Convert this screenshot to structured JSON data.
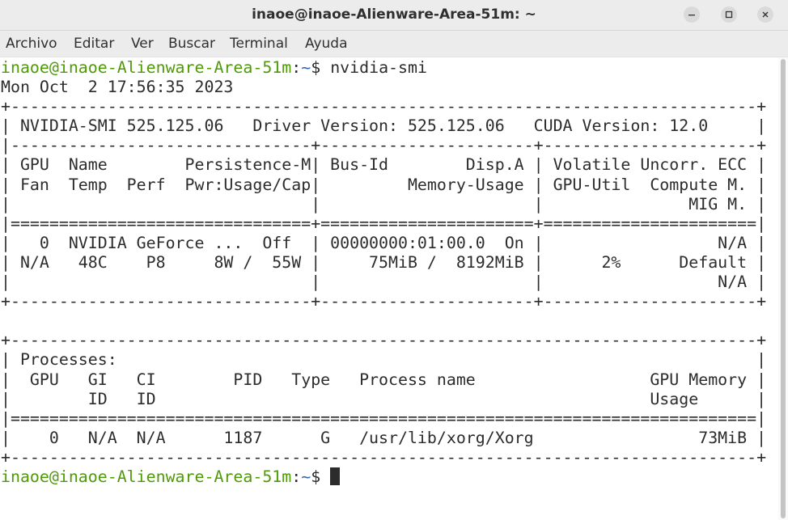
{
  "window": {
    "title": "inaoe@inaoe-Alienware-Area-51m: ~",
    "minimize_icon": "minimize-icon",
    "maximize_icon": "maximize-icon",
    "close_icon": "close-icon"
  },
  "menubar": {
    "items": [
      "Archivo",
      "Editar",
      "Ver",
      "Buscar",
      "Terminal",
      "Ayuda"
    ]
  },
  "terminal": {
    "prompt_user": "inaoe@inaoe-Alienware-Area-51m",
    "prompt_colon": ":",
    "prompt_path": "~",
    "prompt_symbol": "$ ",
    "command": "nvidia-smi",
    "output_lines": [
      "Mon Oct  2 17:56:35 2023",
      "+-----------------------------------------------------------------------------+",
      "| NVIDIA-SMI 525.125.06   Driver Version: 525.125.06   CUDA Version: 12.0     |",
      "|-------------------------------+----------------------+----------------------+",
      "| GPU  Name        Persistence-M| Bus-Id        Disp.A | Volatile Uncorr. ECC |",
      "| Fan  Temp  Perf  Pwr:Usage/Cap|         Memory-Usage | GPU-Util  Compute M. |",
      "|                               |                      |               MIG M. |",
      "|===============================+======================+======================|",
      "|   0  NVIDIA GeForce ...  Off  | 00000000:01:00.0  On |                  N/A |",
      "| N/A   48C    P8     8W /  55W |     75MiB /  8192MiB |      2%      Default |",
      "|                               |                      |                  N/A |",
      "+-------------------------------+----------------------+----------------------+",
      "",
      "+-----------------------------------------------------------------------------+",
      "| Processes:                                                                  |",
      "|  GPU   GI   CI        PID   Type   Process name                  GPU Memory |",
      "|        ID   ID                                                   Usage      |",
      "|=============================================================================|",
      "|    0   N/A  N/A      1187      G   /usr/lib/xorg/Xorg                 73MiB |",
      "+-----------------------------------------------------------------------------+"
    ]
  }
}
